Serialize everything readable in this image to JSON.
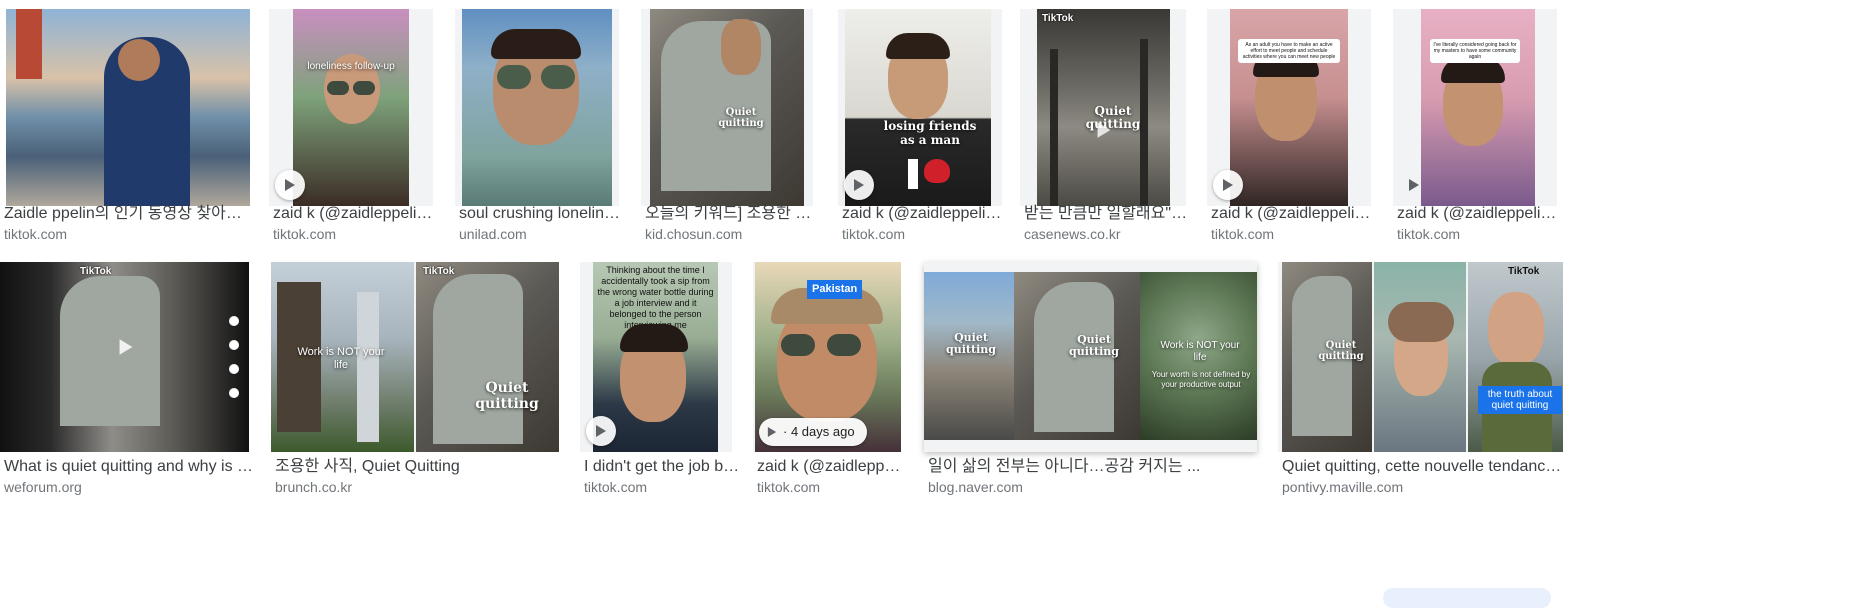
{
  "results": [
    {
      "title": "Zaidle ppelin의 인기 동영상 찾아보기 ...",
      "source": "tiktok.com"
    },
    {
      "title": "zaid k (@zaidleppelin) TikTok ...",
      "source": "tiktok.com"
    },
    {
      "title": "soul crushing loneliness ...",
      "source": "unilad.com"
    },
    {
      "title": "오늘의 키워드] 조용한 사직...",
      "source": "kid.chosun.com"
    },
    {
      "title": "zaid k (@zaidleppelin) TikTok ...",
      "source": "tiktok.com"
    },
    {
      "title": "받는 만큼만 일할래요\"......",
      "source": "casenews.co.kr"
    },
    {
      "title": "zaid k (@zaidleppelin) TikTok ...",
      "source": "tiktok.com"
    },
    {
      "title": "zaid k (@zaidleppelin) TikTok ...",
      "source": "tiktok.com"
    },
    {
      "title": "What is quiet quitting and why is it ...",
      "source": "weforum.org"
    },
    {
      "title": "조용한 사직, Quiet Quitting",
      "source": "brunch.co.kr"
    },
    {
      "title": "I didn't get the job btw ...",
      "source": "tiktok.com"
    },
    {
      "title": "zaid k (@zaidleppelin) ...",
      "source": "tiktok.com"
    },
    {
      "title": "일이 삶의 전부는 아니다…공감 커지는 ...",
      "source": "blog.naver.com"
    },
    {
      "title": "Quiet quitting, cette nouvelle tendance ...",
      "source": "pontivy.maville.com"
    }
  ],
  "overlays": {
    "loneliness": "loneliness follow-up",
    "quiet_quitting": "Quiet quitting",
    "losing_friends": "losing friends as a man",
    "work_not_life": "Work is NOT your life",
    "quiet_quitting_large": "Quiet quitting",
    "water_bottle": "Thinking about the time I accidentally took a sip from the wrong water bottle during a job interview and it belonged to the person interviewing me",
    "pakistan": "Pakistan",
    "work_not_life_2": "Work is NOT your life",
    "worth": "Your worth is not defined by your productive output",
    "truth": "the truth about quiet quitting",
    "tiktok": "TikTok",
    "reply_caption_1": "As an adult you have to make an active effort to meet people and schedule activities where you can meet new people",
    "reply_caption_2": "I've literally considered going back for my masters to have some community again"
  },
  "badges": {
    "time_ago": "· 4 days ago"
  },
  "colors": {
    "title": "#3c4043",
    "source": "#70757a",
    "thumb_bg": "#f1f3f4"
  },
  "icons": [
    "play-icon"
  ]
}
